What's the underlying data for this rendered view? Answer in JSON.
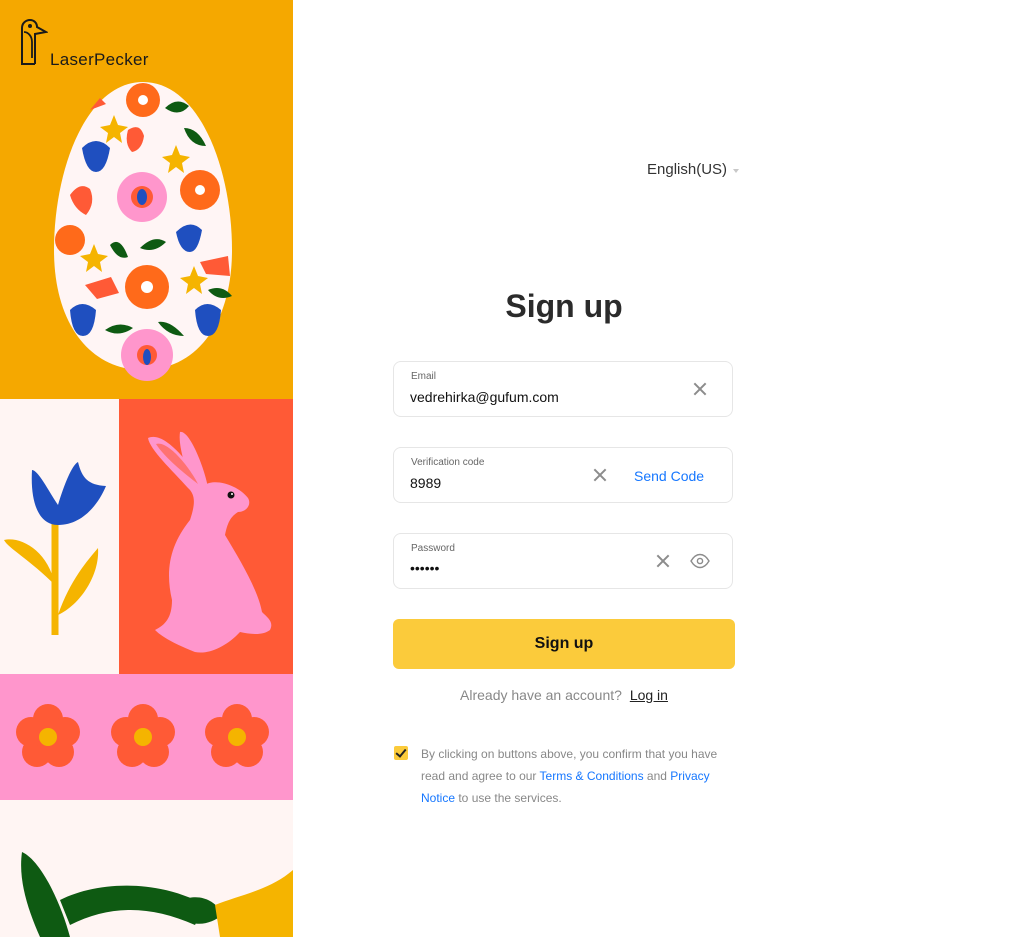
{
  "brand": {
    "name": "LaserPecker",
    "logo": "laserpecker-bird-logo"
  },
  "header": {
    "language": "English(US)",
    "language_icon": "caret-down-icon"
  },
  "form": {
    "title": "Sign up",
    "email": {
      "label": "Email",
      "value": "vedrehirka@gufum.com",
      "clear_icon": "close-icon"
    },
    "verification": {
      "label": "Verification code",
      "value": "8989",
      "send_label": "Send Code",
      "clear_icon": "close-icon"
    },
    "password": {
      "label": "Password",
      "value": "••••••",
      "clear_icon": "close-icon",
      "visibility_icon": "eye-icon"
    },
    "submit_label": "Sign up"
  },
  "footer": {
    "have_account": "Already have an account?",
    "login_link": "Log in",
    "consent": {
      "checked": true,
      "text_before": "By clicking on buttons above, you confirm that you have read and agree to our ",
      "terms_link": "Terms & Conditions",
      "text_middle": " and ",
      "privacy_link": "Privacy Notice",
      "text_after": " to use the services."
    }
  },
  "colors": {
    "accent_yellow": "#fbcb3b",
    "link_blue": "#1677ff",
    "panel_orange": "#f5a800",
    "bunny_red": "#ff5a36",
    "bunny_pink": "#ff96cc",
    "flower_blue": "#1f4fbf",
    "leaf_green": "#0e5a12"
  },
  "illustrations": [
    "easter-egg-illustration",
    "tulip-illustration",
    "bunny-illustration",
    "flowers-illustration",
    "leaves-illustration"
  ]
}
